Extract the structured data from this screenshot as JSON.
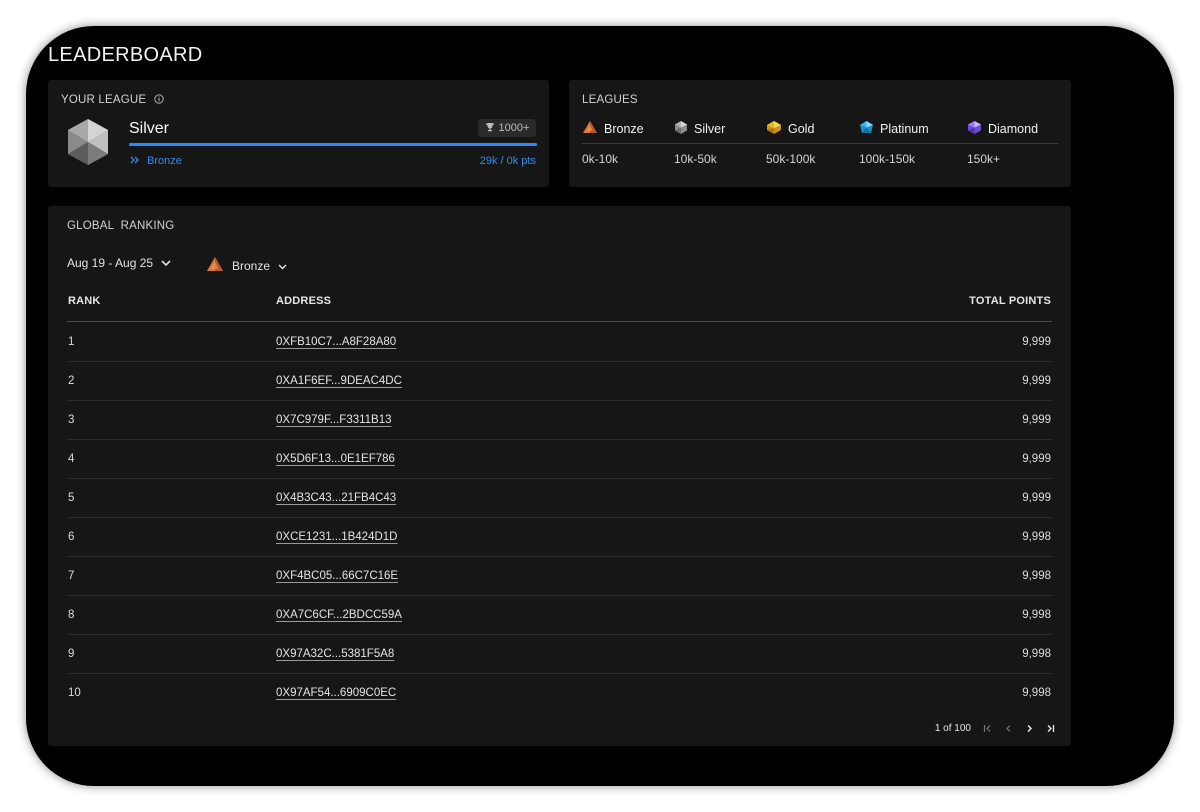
{
  "page": {
    "title": "LEADERBOARD"
  },
  "your_league": {
    "heading": "YOUR LEAGUE",
    "current_league": "Silver",
    "trophy_badge": "1000+",
    "progress_percent": 100,
    "next_league": "Bronze",
    "points_text": "29k / 0k pts"
  },
  "leagues": {
    "heading": "LEAGUES",
    "items": [
      {
        "name": "Bronze",
        "range": "0k-10k",
        "color": "#e0793a"
      },
      {
        "name": "Silver",
        "range": "10k-50k",
        "color": "#b8b8b8"
      },
      {
        "name": "Gold",
        "range": "50k-100k",
        "color": "#e7b923"
      },
      {
        "name": "Platinum",
        "range": "100k-150k",
        "color": "#3ab7e8"
      },
      {
        "name": "Diamond",
        "range": "150k+",
        "color": "#8f6ee8"
      }
    ]
  },
  "ranking": {
    "heading": "GLOBAL  RANKING",
    "date_filter": "Aug 19 - Aug 25",
    "league_filter": "Bronze",
    "columns": {
      "rank": "RANK",
      "address": "ADDRESS",
      "points": "TOTAL POINTS"
    },
    "rows": [
      {
        "rank": "1",
        "address": "0XFB10C7...A8F28A80",
        "points": "9,999"
      },
      {
        "rank": "2",
        "address": "0XA1F6EF...9DEAC4DC",
        "points": "9,999"
      },
      {
        "rank": "3",
        "address": "0X7C979F...F3311B13",
        "points": "9,999"
      },
      {
        "rank": "4",
        "address": "0X5D6F13...0E1EF786",
        "points": "9,999"
      },
      {
        "rank": "5",
        "address": "0X4B3C43...21FB4C43",
        "points": "9,999"
      },
      {
        "rank": "6",
        "address": "0XCE1231...1B424D1D",
        "points": "9,998"
      },
      {
        "rank": "7",
        "address": "0XF4BC05...66C7C16E",
        "points": "9,998"
      },
      {
        "rank": "8",
        "address": "0XA7C6CF...2BDCC59A",
        "points": "9,998"
      },
      {
        "rank": "9",
        "address": "0X97A32C...5381F5A8",
        "points": "9,998"
      },
      {
        "rank": "10",
        "address": "0X97AF54...6909C0EC",
        "points": "9,998"
      }
    ],
    "pagination": {
      "text": "1 of 100"
    }
  }
}
